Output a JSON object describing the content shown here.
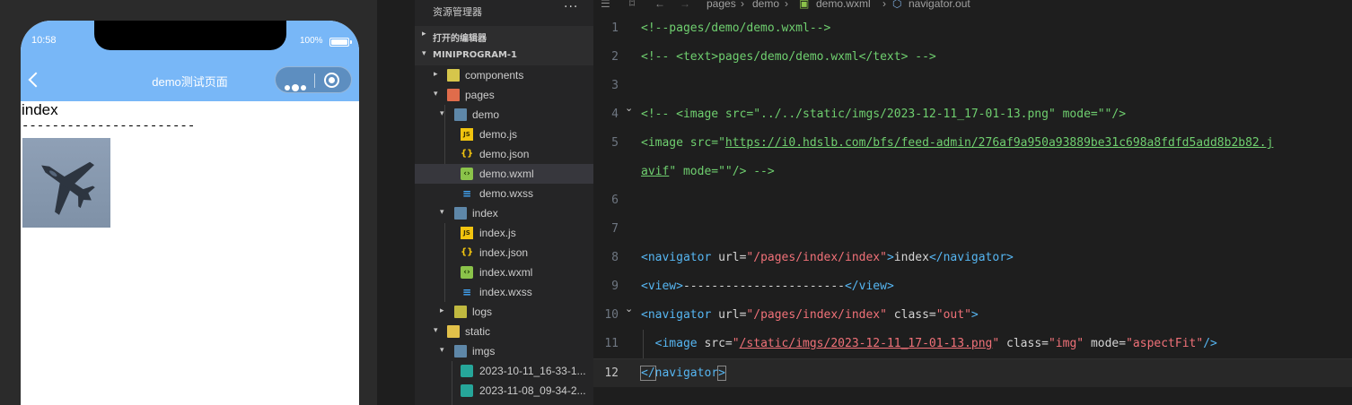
{
  "simulator": {
    "time": "10:58",
    "battery": "100%",
    "nav_title": "demo测试页面",
    "page_link": "index",
    "page_divider": "-----------------------"
  },
  "explorer": {
    "title": "资源管理器",
    "more": "···",
    "open_editors": "打开的编辑器",
    "project": "MINIPROGRAM-1",
    "items": [
      {
        "label": "components",
        "icon": "folder-components-icon",
        "expanded": false
      },
      {
        "label": "pages",
        "icon": "folder-pages-icon",
        "expanded": true
      },
      {
        "label": "demo",
        "icon": "folder-open-icon",
        "expanded": true
      },
      {
        "label": "demo.js",
        "icon": "js-file-icon"
      },
      {
        "label": "demo.json",
        "icon": "json-file-icon"
      },
      {
        "label": "demo.wxml",
        "icon": "wxml-file-icon",
        "selected": true
      },
      {
        "label": "demo.wxss",
        "icon": "wxss-file-icon"
      },
      {
        "label": "index",
        "icon": "folder-open-icon",
        "expanded": true
      },
      {
        "label": "index.js",
        "icon": "js-file-icon"
      },
      {
        "label": "index.json",
        "icon": "json-file-icon"
      },
      {
        "label": "index.wxml",
        "icon": "wxml-file-icon"
      },
      {
        "label": "index.wxss",
        "icon": "wxss-file-icon"
      },
      {
        "label": "logs",
        "icon": "folder-logs-icon",
        "expanded": false
      },
      {
        "label": "static",
        "icon": "folder-static-icon",
        "expanded": true
      },
      {
        "label": "imgs",
        "icon": "folder-open-icon",
        "expanded": true
      },
      {
        "label": "2023-10-11_16-33-1...",
        "icon": "image-file-icon"
      },
      {
        "label": "2023-11-08_09-34-2...",
        "icon": "image-file-icon"
      }
    ]
  },
  "editor": {
    "breadcrumb": [
      "pages",
      "demo",
      "demo.wxml",
      "navigator.out"
    ],
    "lines": [
      {
        "n": "1",
        "segments": [
          [
            "<!--pages/demo/demo.wxml-->",
            "green"
          ]
        ]
      },
      {
        "n": "2",
        "segments": [
          [
            "<!-- <text>pages/demo/demo.wxml</text> -->",
            "green"
          ]
        ]
      },
      {
        "n": "3",
        "segments": []
      },
      {
        "n": "4",
        "segments": [
          [
            "<!-- <image src=\"../../static/imgs/2023-12-11_17-01-13.png\" mode=\"\"/>",
            "green"
          ]
        ]
      },
      {
        "n": "5",
        "segments": [
          [
            "<image src=\"",
            "green"
          ],
          [
            "https://i0.hdslb.com/bfs/feed-admin/276af9a950a93889be31c698a8fdfd5add8b2b82.j",
            "green-u"
          ]
        ]
      },
      {
        "n": "",
        "segments": [
          [
            "avif",
            "green-u"
          ],
          [
            "\" mode=\"\"/> -->",
            "green"
          ]
        ]
      },
      {
        "n": "6",
        "segments": []
      },
      {
        "n": "7",
        "segments": []
      },
      {
        "n": "8",
        "segments": [
          [
            "<",
            "tag"
          ],
          [
            "navigator",
            "tag"
          ],
          [
            " url=",
            "attr"
          ],
          [
            "\"/pages/index/index\"",
            "str"
          ],
          [
            ">",
            "tag"
          ],
          [
            "index",
            "text"
          ],
          [
            "</",
            "tag"
          ],
          [
            "navigator",
            "tag"
          ],
          [
            ">",
            "tag"
          ]
        ]
      },
      {
        "n": "9",
        "segments": [
          [
            "<",
            "tag"
          ],
          [
            "view",
            "tag"
          ],
          [
            ">",
            "tag"
          ],
          [
            "-----------------------",
            "text"
          ],
          [
            "</",
            "tag"
          ],
          [
            "view",
            "tag"
          ],
          [
            ">",
            "tag"
          ]
        ]
      },
      {
        "n": "10",
        "segments": [
          [
            "<",
            "tag"
          ],
          [
            "navigator",
            "tag"
          ],
          [
            " url=",
            "attr"
          ],
          [
            "\"/pages/index/index\"",
            "str"
          ],
          [
            " class=",
            "attr"
          ],
          [
            "\"out\"",
            "str"
          ],
          [
            ">",
            "tag"
          ]
        ]
      },
      {
        "n": "11",
        "segments": [
          [
            "  <",
            "tag"
          ],
          [
            "image",
            "tag"
          ],
          [
            " src=",
            "attr"
          ],
          [
            "\"",
            "str"
          ],
          [
            "/static/imgs/2023-12-11_17-01-13.png",
            "str-u"
          ],
          [
            "\"",
            "str"
          ],
          [
            " class=",
            "attr"
          ],
          [
            "\"img\"",
            "str"
          ],
          [
            " mode=",
            "attr"
          ],
          [
            "\"aspectFit\"",
            "str"
          ],
          [
            "/>",
            "tag"
          ]
        ]
      },
      {
        "n": "12",
        "segments": [
          [
            "</",
            "tag"
          ],
          [
            "navigator",
            "tag"
          ],
          [
            ">",
            "tag"
          ]
        ]
      }
    ]
  },
  "colors": {
    "nav_bar": "#78b7f7",
    "tag": "#56b6f2",
    "string": "#f07178",
    "comment": "#6fcf6f"
  }
}
